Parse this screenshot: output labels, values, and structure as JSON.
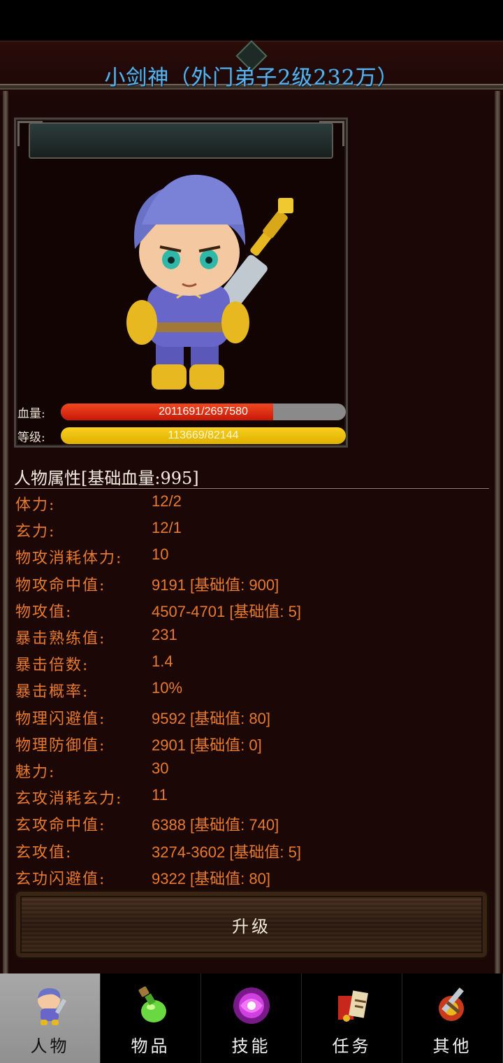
{
  "page_title": "小剑神（外门弟子2级232万）",
  "hp": {
    "label": "血量:",
    "text": "2011691/2697580",
    "fraction": 0.7457
  },
  "level": {
    "label": "等级:",
    "text": "113669/82144",
    "fraction": 1.0
  },
  "attributes": {
    "title": "人物属性[基础血量:995]",
    "rows": [
      {
        "label": "体力:",
        "value": "12/2"
      },
      {
        "label": "玄力:",
        "value": "12/1"
      },
      {
        "label": "物攻消耗体力:",
        "value": "10"
      },
      {
        "label": "物攻命中值:",
        "value": "9191 [基础值: 900]"
      },
      {
        "label": "物攻值:",
        "value": "4507-4701 [基础值: 5]"
      },
      {
        "label": "暴击熟练值:",
        "value": "231"
      },
      {
        "label": "暴击倍数:",
        "value": "1.4"
      },
      {
        "label": "暴击概率:",
        "value": "10%"
      },
      {
        "label": "物理闪避值:",
        "value": "9592 [基础值: 80]"
      },
      {
        "label": "物理防御值:",
        "value": "2901 [基础值: 0]"
      },
      {
        "label": "魅力:",
        "value": "30"
      },
      {
        "label": "玄攻消耗玄力:",
        "value": "11"
      },
      {
        "label": "玄攻命中值:",
        "value": "6388 [基础值: 740]"
      },
      {
        "label": "玄攻值:",
        "value": "3274-3602 [基础值: 5]"
      },
      {
        "label": "玄功闪避值:",
        "value": "9322 [基础值: 80]"
      }
    ]
  },
  "upgrade_label": "升级",
  "tabs": [
    {
      "label": "人物",
      "icon": "character-icon",
      "active": true
    },
    {
      "label": "物品",
      "icon": "potion-icon",
      "active": false
    },
    {
      "label": "技能",
      "icon": "skill-orb-icon",
      "active": false
    },
    {
      "label": "任务",
      "icon": "quest-icon",
      "active": false
    },
    {
      "label": "其他",
      "icon": "other-icon",
      "active": false
    }
  ],
  "colors": {
    "title": "#5fb0e8",
    "stat_text": "#e87a2c",
    "hp_bar": "#e02a10",
    "level_bar": "#f0c000",
    "panel_bg": "#1c0707"
  }
}
